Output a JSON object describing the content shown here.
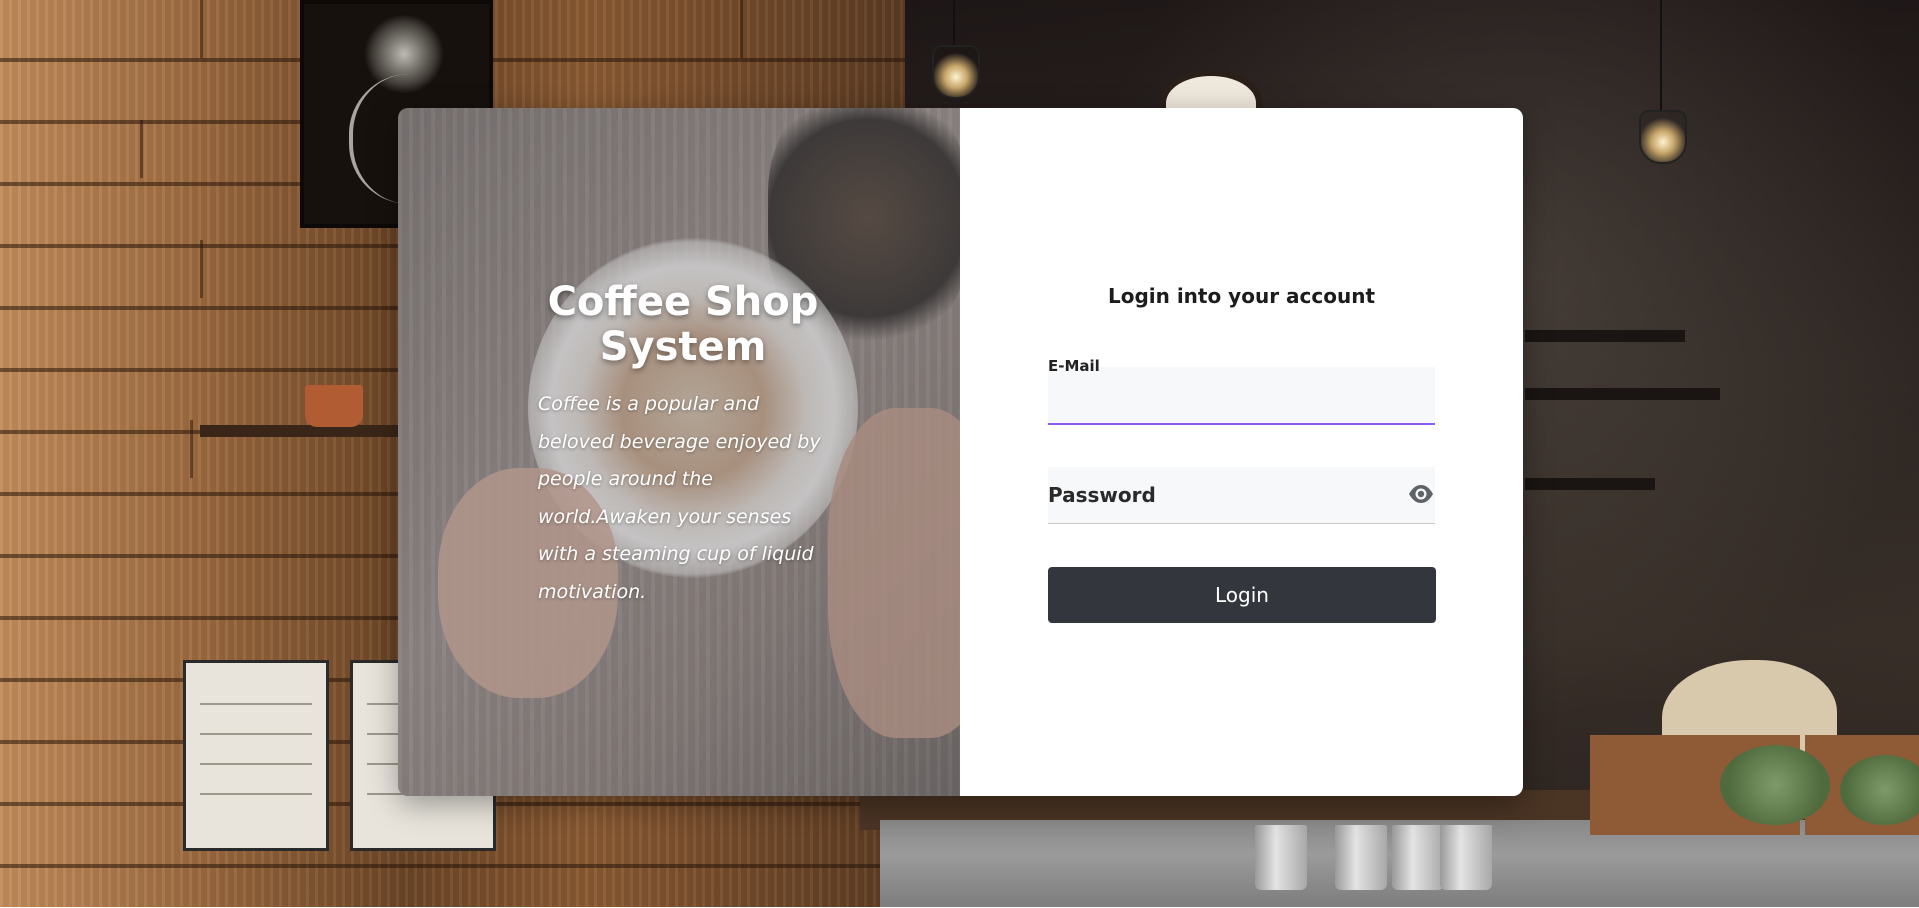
{
  "brand": {
    "title": "Coffee Shop System",
    "tagline": "Coffee is a popular and beloved beverage enjoyed by people around the world.Awaken your senses with a steaming cup of liquid motivation."
  },
  "login": {
    "heading": "Login into your account",
    "email_label": "E-Mail",
    "email_value": "",
    "password_label": "Password",
    "password_value": "",
    "submit_label": "Login"
  },
  "icons": {
    "password_toggle": "eye-icon"
  },
  "colors": {
    "button_bg": "#33363d",
    "focus_underline": "#8a5cf5",
    "field_bg": "#f7f8fa"
  }
}
